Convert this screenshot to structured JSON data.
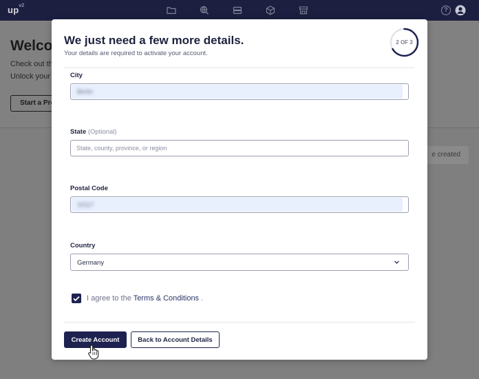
{
  "app": {
    "logo": "up",
    "logo_sup": "v2"
  },
  "topbar": {
    "icons": [
      "folder-icon",
      "globe-search-icon",
      "server-icon",
      "cube-icon",
      "storefront-icon",
      "help-icon",
      "user-icon"
    ],
    "help_glyph": "?"
  },
  "background_page": {
    "title": "Welcome",
    "line1": "Check out th",
    "line2": "Unlock your",
    "button_label": "Start a Pro",
    "chip_label": "e created"
  },
  "modal": {
    "title": "We just need a few more details.",
    "subtitle": "Your details are required to activate your account.",
    "step": {
      "label": "2 OF 3",
      "current": 2,
      "total": 3
    },
    "fields": {
      "city": {
        "label": "City",
        "value": "Berlin"
      },
      "state": {
        "label": "State",
        "optional": "(Optional)",
        "placeholder": "State, county, province, or region",
        "value": ""
      },
      "postal": {
        "label": "Postal Code",
        "value": "10117"
      },
      "country": {
        "label": "Country",
        "value": "Germany"
      }
    },
    "terms": {
      "prefix": "I agree to the",
      "link": "Terms & Conditions",
      "suffix": ".",
      "checked": true
    },
    "buttons": {
      "create": "Create Account",
      "back": "Back to Account Details"
    }
  },
  "colors": {
    "navy": "#1e2250",
    "topbar": "#1c1f40",
    "autofill": "#e8f0fe",
    "overlay": "#7f7f7f"
  }
}
